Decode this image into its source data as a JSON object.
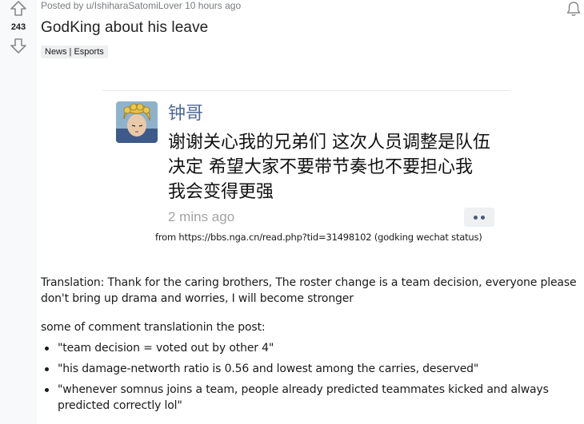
{
  "post": {
    "score": "243",
    "meta": "Posted by u/IshiharaSatomiLover 10 hours ago",
    "title": "GodKing about his leave",
    "flair": "News | Esports"
  },
  "wechat_status": {
    "name": "钟哥",
    "lines": [
      "谢谢关心我的兄弟们 这次人员调整是队伍",
      "决定 希望大家不要带节奏也不要担心我",
      "我会变得更强"
    ],
    "time": "2 mins ago",
    "caption": "from https://bbs.nga.cn/read.php?tid=31498102 (godking wechat status)"
  },
  "body": {
    "translation": "Translation: Thank for the caring brothers, The roster change is a team decision, everyone please don't bring up drama and worries, I will become stronger",
    "intro": "some of comment translationin the post:",
    "comments": [
      "\"team decision = voted out by other 4\"",
      "\"his damage-networth ratio is 0.56 and lowest among the carries, deserved\"",
      "\"whenever somnus joins a team, people already predicted teammates kicked and always predicted correctly lol\""
    ]
  },
  "icons": {
    "upvote": "upvote-arrow-icon",
    "downvote": "downvote-arrow-icon",
    "bell": "bell-icon",
    "more": "more-dots-icon"
  },
  "colors": {
    "name_blue": "#4e6a96",
    "meta_gray": "#787c7e",
    "vote_bg": "#f8f9fa"
  }
}
